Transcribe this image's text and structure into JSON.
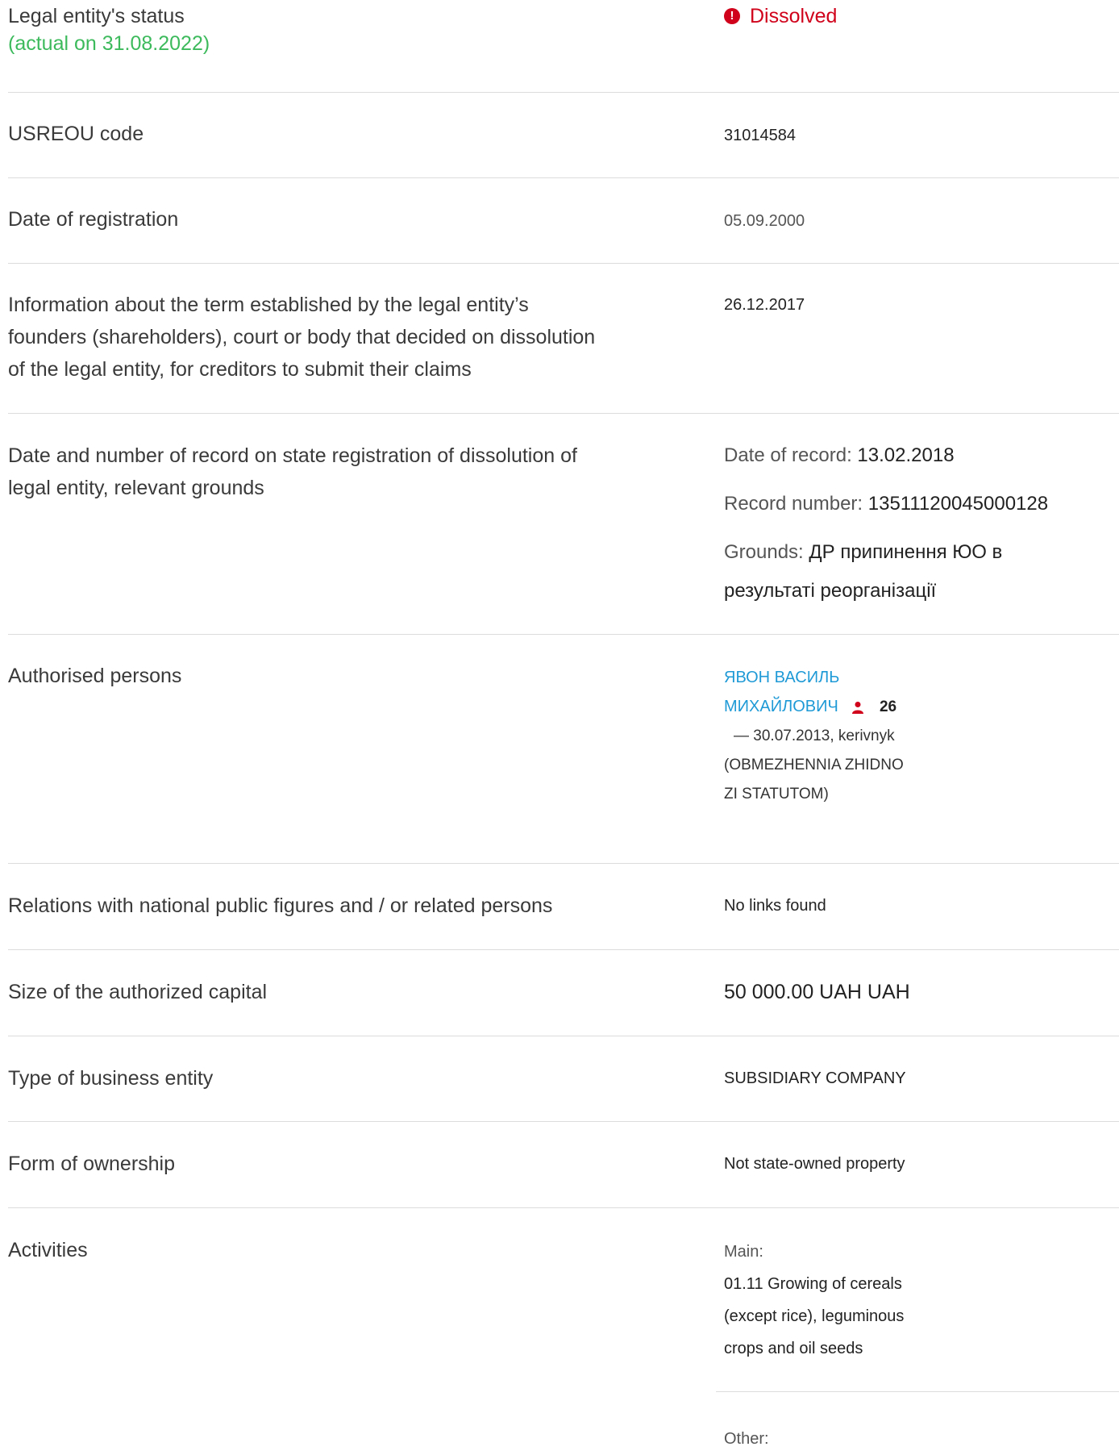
{
  "status": {
    "label": "Legal entity's status",
    "actual_on": "(actual on 31.08.2022)",
    "value": "Dissolved",
    "icon": "alert-circle-icon",
    "color": "#d0021b"
  },
  "usreou": {
    "label": "USREOU code",
    "value": "31014584"
  },
  "registration": {
    "label": "Date of registration",
    "value": "05.09.2000"
  },
  "creditors_term": {
    "label_lines": [
      "Information about the term established by the legal entity’s",
      "founders (shareholders), court or body that decided on dissolution",
      "of the legal entity, for creditors to submit their claims"
    ],
    "value": "26.12.2017"
  },
  "dissolution_record": {
    "label_lines": [
      "Date and number of record on state registration of dissolution of",
      "legal entity, relevant grounds"
    ],
    "date_label": "Date of record:",
    "date_value": "13.02.2018",
    "number_label": "Record number:",
    "number_value": "13511120045000128",
    "grounds_label": "Grounds:",
    "grounds_line1": "ДР припинення ЮО в",
    "grounds_line2": "результаті реорганізації"
  },
  "authorised": {
    "label": "Authorised persons",
    "person_name_line1": "ЯВОН ВАСИЛЬ",
    "person_name_line2": "МИХАЙЛОВИЧ",
    "person_icon": "person-icon",
    "person_count": "26",
    "detail_line1": "— 30.07.2013, kerivnyk",
    "detail_line2": "(OBMEZHENNIA ZHIDNO",
    "detail_line3": "ZI STATUTOM)"
  },
  "relations": {
    "label": "Relations with national public figures and / or related persons",
    "value": "No links found"
  },
  "capital": {
    "label": "Size of the authorized capital",
    "value": "50 000.00 UAH UAH"
  },
  "business_type": {
    "label": "Type of business entity",
    "value": "SUBSIDIARY COMPANY"
  },
  "ownership": {
    "label": "Form of ownership",
    "value": "Not state-owned property"
  },
  "activities": {
    "label": "Activities",
    "main_label": "Main:",
    "main_lines": [
      "01.11 Growing of cereals",
      "(except rice), leguminous",
      "crops and oil seeds"
    ],
    "other_label": "Other:"
  }
}
